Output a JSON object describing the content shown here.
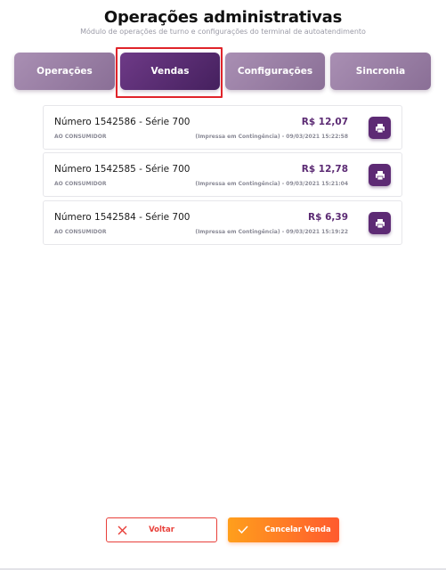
{
  "header": {
    "title": "Operações administrativas",
    "subtitle": "Módulo de operações de turno e configurações do terminal de autoatendimento"
  },
  "tabs": [
    {
      "label": "Operações",
      "active": false
    },
    {
      "label": "Vendas",
      "active": true
    },
    {
      "label": "Configurações",
      "active": false
    },
    {
      "label": "Sincronia",
      "active": false
    }
  ],
  "sales": [
    {
      "number": "Número 1542586 - Série 700",
      "customer": "AO CONSUMIDOR",
      "amount": "R$ 12,07",
      "status": "(Impressa em Contingência) - 09/03/2021 15:22:58",
      "print_icon": "printer-icon"
    },
    {
      "number": "Número 1542585 - Série 700",
      "customer": "AO CONSUMIDOR",
      "amount": "R$ 12,78",
      "status": "(Impressa em Contingência) - 09/03/2021 15:21:04",
      "print_icon": "printer-icon"
    },
    {
      "number": "Número 1542584 - Série 700",
      "customer": "AO CONSUMIDOR",
      "amount": "R$ 6,39",
      "status": "(Impressa em Contingência) - 09/03/2021 15:19:22",
      "print_icon": "printer-icon"
    }
  ],
  "footer": {
    "back_label": "Voltar",
    "back_icon": "close-icon",
    "cancel_label": "Cancelar Venda",
    "cancel_icon": "check-icon"
  },
  "colors": {
    "accent": "#5d2a74",
    "tab_inactive": "#9c84a8",
    "tab_active": "#5a2c75",
    "amount": "#5b2a73",
    "danger": "#e8403a",
    "cancel_gradient_start": "#ff9f1c",
    "cancel_gradient_end": "#ff5a2e"
  }
}
